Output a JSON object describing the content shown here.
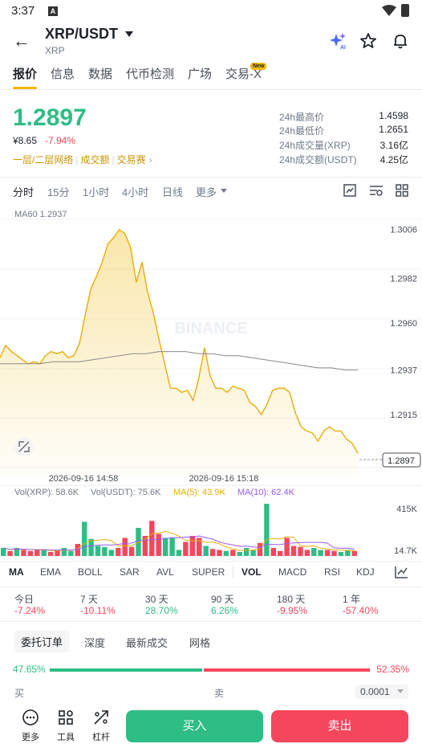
{
  "status": {
    "time": "3:37",
    "badge": "A"
  },
  "header": {
    "pair": "XRP/USDT",
    "base": "XRP"
  },
  "tabs": [
    "报价",
    "信息",
    "数据",
    "代币检测",
    "广场",
    "交易-X"
  ],
  "tab_badge": "New",
  "ticker": {
    "price": "1.2897",
    "fiat": "¥8.65",
    "change": "-7.94%",
    "links": [
      "一层/二层网络",
      "成交额",
      "交易赛"
    ],
    "stats": [
      {
        "label": "24h最高价",
        "value": "1.4598"
      },
      {
        "label": "24h最低价",
        "value": "1.2651"
      },
      {
        "label": "24h成交量(XRP)",
        "value": "3.16亿"
      },
      {
        "label": "24h成交额(USDT)",
        "value": "4.25亿"
      }
    ]
  },
  "intervals": [
    "分时",
    "15分",
    "1小时",
    "4小时",
    "日线",
    "更多"
  ],
  "chart_data": {
    "type": "line",
    "ma_label": "MA60 1.2937",
    "watermark": "BINANCE",
    "current_price_label": "1.2897",
    "y_ticks": [
      "1.3006",
      "1.2982",
      "1.2960",
      "1.2937",
      "1.2915"
    ],
    "ylim": [
      1.2889,
      1.3011
    ],
    "x_ticks": [
      "2026-09-16 14:58",
      "2026-09-16 15:18"
    ],
    "price": [
      1.2943,
      1.2949,
      1.2946,
      1.2944,
      1.2942,
      1.294,
      1.2941,
      1.294,
      1.2944,
      1.2946,
      1.2945,
      1.2946,
      1.2943,
      1.2944,
      1.295,
      1.2964,
      1.2977,
      1.2983,
      1.299,
      1.2999,
      1.3002,
      1.3006,
      1.3004,
      1.2997,
      1.298,
      1.299,
      1.2975,
      1.2965,
      1.2952,
      1.294,
      1.2928,
      1.2928,
      1.2926,
      1.2927,
      1.2922,
      1.2933,
      1.2948,
      1.2934,
      1.2928,
      1.2928,
      1.2926,
      1.2929,
      1.2928,
      1.2927,
      1.2921,
      1.2919,
      1.2915,
      1.292,
      1.2927,
      1.2928,
      1.2928,
      1.2926,
      1.2916,
      1.2909,
      1.2907,
      1.2906,
      1.2902,
      1.2907,
      1.2909,
      1.2907,
      1.2907,
      1.2903,
      1.2901,
      1.2896
    ],
    "ma60": [
      1.294,
      1.294,
      1.294,
      1.294,
      1.2941,
      1.2941,
      1.2941,
      1.2942,
      1.2943,
      1.2944,
      1.2945,
      1.2945,
      1.2946,
      1.2946,
      1.2946,
      1.2945,
      1.2945,
      1.2944,
      1.2944,
      1.2943,
      1.2942,
      1.2941,
      1.294,
      1.2939,
      1.2938,
      1.2938,
      1.2937,
      1.2937
    ],
    "volume_labels": {
      "vol_xrp": "Vol(XRP): 58.6K",
      "vol_usdt": "Vol(USDT): 75.6K",
      "ma5": "MA(5): 43.9K",
      "ma10": "MA(10): 62.4K"
    },
    "volume_axis": [
      "415K",
      "14.7K"
    ],
    "volume": [
      {
        "v": 40,
        "c": "g"
      },
      {
        "v": 25,
        "c": "r"
      },
      {
        "v": 40,
        "c": "g"
      },
      {
        "v": 30,
        "c": "r"
      },
      {
        "v": 25,
        "c": "r"
      },
      {
        "v": 30,
        "c": "r"
      },
      {
        "v": 30,
        "c": "g"
      },
      {
        "v": 20,
        "c": "r"
      },
      {
        "v": 28,
        "c": "r"
      },
      {
        "v": 40,
        "c": "g"
      },
      {
        "v": 25,
        "c": "g"
      },
      {
        "v": 60,
        "c": "r"
      },
      {
        "v": 170,
        "c": "g"
      },
      {
        "v": 85,
        "c": "g"
      },
      {
        "v": 50,
        "c": "g"
      },
      {
        "v": 45,
        "c": "g"
      },
      {
        "v": 30,
        "c": "g"
      },
      {
        "v": 40,
        "c": "r"
      },
      {
        "v": 90,
        "c": "r"
      },
      {
        "v": 45,
        "c": "r"
      },
      {
        "v": 140,
        "c": "g"
      },
      {
        "v": 100,
        "c": "r"
      },
      {
        "v": 175,
        "c": "r"
      },
      {
        "v": 110,
        "c": "r"
      },
      {
        "v": 90,
        "c": "g"
      },
      {
        "v": 90,
        "c": "g"
      },
      {
        "v": 30,
        "c": "g"
      },
      {
        "v": 70,
        "c": "r"
      },
      {
        "v": 100,
        "c": "r"
      },
      {
        "v": 90,
        "c": "r"
      },
      {
        "v": 50,
        "c": "g"
      },
      {
        "v": 35,
        "c": "r"
      },
      {
        "v": 30,
        "c": "r"
      },
      {
        "v": 25,
        "c": "g"
      },
      {
        "v": 30,
        "c": "r"
      },
      {
        "v": 20,
        "c": "g"
      },
      {
        "v": 40,
        "c": "g"
      },
      {
        "v": 30,
        "c": "g"
      },
      {
        "v": 65,
        "c": "r"
      },
      {
        "v": 260,
        "c": "g"
      },
      {
        "v": 40,
        "c": "r"
      },
      {
        "v": 25,
        "c": "r"
      },
      {
        "v": 90,
        "c": "r"
      },
      {
        "v": 50,
        "c": "r"
      },
      {
        "v": 45,
        "c": "r"
      },
      {
        "v": 30,
        "c": "r"
      },
      {
        "v": 40,
        "c": "g"
      },
      {
        "v": 30,
        "c": "g"
      },
      {
        "v": 30,
        "c": "r"
      },
      {
        "v": 25,
        "c": "r"
      },
      {
        "v": 20,
        "c": "g"
      },
      {
        "v": 30,
        "c": "g"
      },
      {
        "v": 25,
        "c": "r"
      }
    ]
  },
  "indicators": [
    "MA",
    "EMA",
    "BOLL",
    "SAR",
    "AVL",
    "SUPER",
    "VOL",
    "MACD",
    "RSI",
    "KDJ"
  ],
  "performance": [
    {
      "label": "今日",
      "value": "-7.24%",
      "dir": "down"
    },
    {
      "label": "7 天",
      "value": "-10.11%",
      "dir": "down"
    },
    {
      "label": "30 天",
      "value": "28.70%",
      "dir": "up"
    },
    {
      "label": "90 天",
      "value": "6.26%",
      "dir": "up"
    },
    {
      "label": "180 天",
      "value": "-9.95%",
      "dir": "down"
    },
    {
      "label": "1 年",
      "value": "-57.40%",
      "dir": "down"
    }
  ],
  "orderbook": {
    "tabs": [
      "委托订单",
      "深度",
      "最新成交",
      "网格"
    ],
    "buy_ratio": "47.65%",
    "sell_ratio": "52.35%",
    "buy_label": "买",
    "sell_label": "卖",
    "precision": "0.0001"
  },
  "bottom": {
    "more": "更多",
    "tools": "工具",
    "leverage": "杠杆",
    "buy": "买入",
    "sell": "卖出"
  },
  "colors": {
    "up": "#2ebd85",
    "down": "#f6465d",
    "accent": "#f0b90b",
    "brand_link": "#c99400"
  }
}
